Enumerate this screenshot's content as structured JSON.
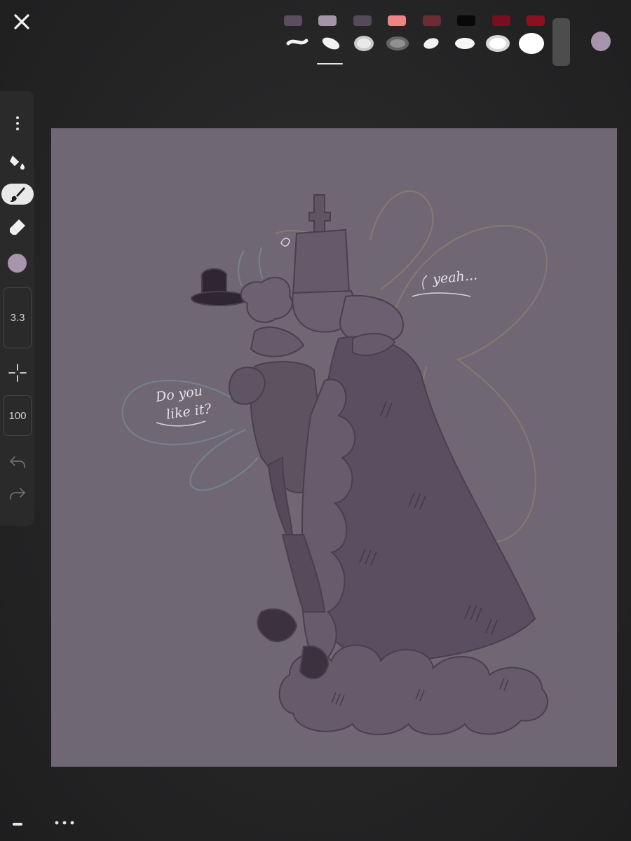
{
  "top_bar": {
    "close_icon": "close-icon",
    "palette": [
      "#5c4d62",
      "#a595ab",
      "#554a5a",
      "#f08383",
      "#6b2c35",
      "#080808",
      "#7a0e1e",
      "#8e1020"
    ],
    "brushes": [
      "brush-preset-1",
      "brush-preset-2",
      "brush-preset-3",
      "brush-preset-4",
      "brush-preset-5",
      "brush-preset-6",
      "brush-preset-7",
      "brush-preset-8"
    ],
    "selected_brush_index": 1,
    "current_color": "#a795ab"
  },
  "toolbar": {
    "menu_icon": "more-vertical-icon",
    "tools": [
      "fill-bucket-icon",
      "brush-icon",
      "eraser-icon"
    ],
    "active_tool": "brush-icon",
    "color": "#a795ab",
    "brush_size": "3.3",
    "opacity": "100",
    "move_icon": "crosshair-icon",
    "undo_icon": "undo-icon",
    "redo_icon": "redo-icon"
  },
  "canvas": {
    "background": "#6f6874",
    "line_color": "#4a3e4f",
    "speech_left": [
      "Do you",
      "like it?"
    ],
    "speech_right": "yeah..."
  },
  "bottom_bar": {
    "minus_icon": "minus-icon",
    "more_icon": "more-horizontal-icon"
  }
}
